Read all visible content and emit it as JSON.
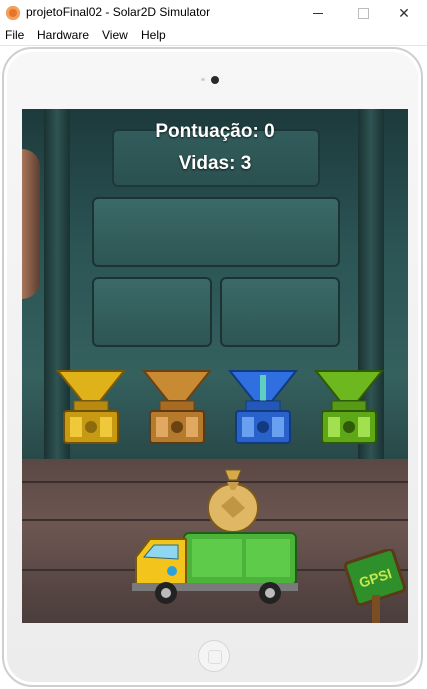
{
  "window": {
    "title": "projetoFinal02 - Solar2D Simulator",
    "close_glyph": "✕"
  },
  "menu": {
    "items": [
      "File",
      "Hardware",
      "View",
      "Help"
    ]
  },
  "game": {
    "score_text": "Pontuação: 0",
    "lives_text": "Vidas: 3",
    "bins": [
      {
        "name": "yellow-bin",
        "color": "#e0b21a"
      },
      {
        "name": "orange-bin",
        "color": "#c98a34"
      },
      {
        "name": "blue-bin",
        "color": "#2f6fe0"
      },
      {
        "name": "green-bin",
        "color": "#6cb81e"
      }
    ],
    "logo_text": "GPSI"
  }
}
